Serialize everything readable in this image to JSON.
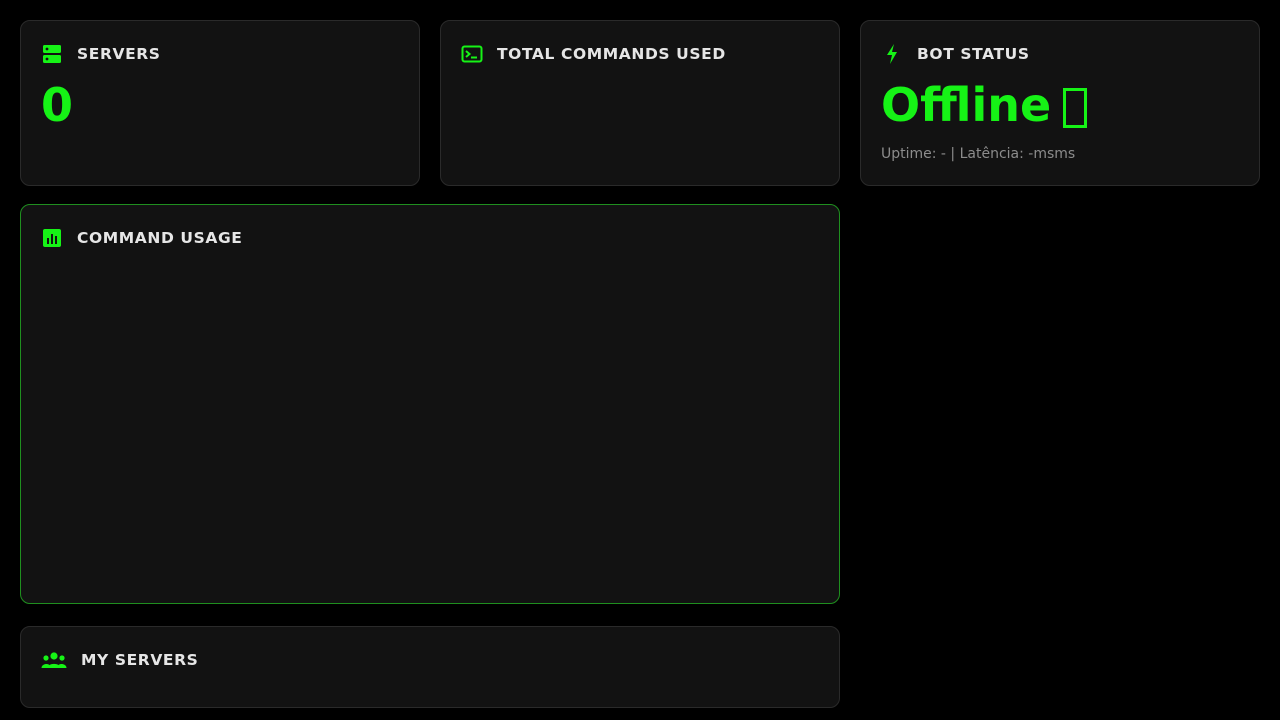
{
  "theme": {
    "accent": "#16f316",
    "card_bg": "#121212",
    "background": "#000000"
  },
  "cards": {
    "servers": {
      "title": "SERVERS",
      "value": "0",
      "icon": "server-icon"
    },
    "total_commands": {
      "title": "TOTAL COMMANDS USED",
      "value": "",
      "icon": "terminal-icon"
    },
    "bot_status": {
      "title": "BOT STATUS",
      "status": "Offline",
      "status_indicator": "□",
      "uptime_line": "Uptime: - | Latência: -msms",
      "icon": "lightning-icon"
    },
    "command_usage": {
      "title": "COMMAND USAGE",
      "icon": "bar-chart-icon"
    },
    "my_servers": {
      "title": "MY SERVERS",
      "icon": "users-icon"
    }
  }
}
